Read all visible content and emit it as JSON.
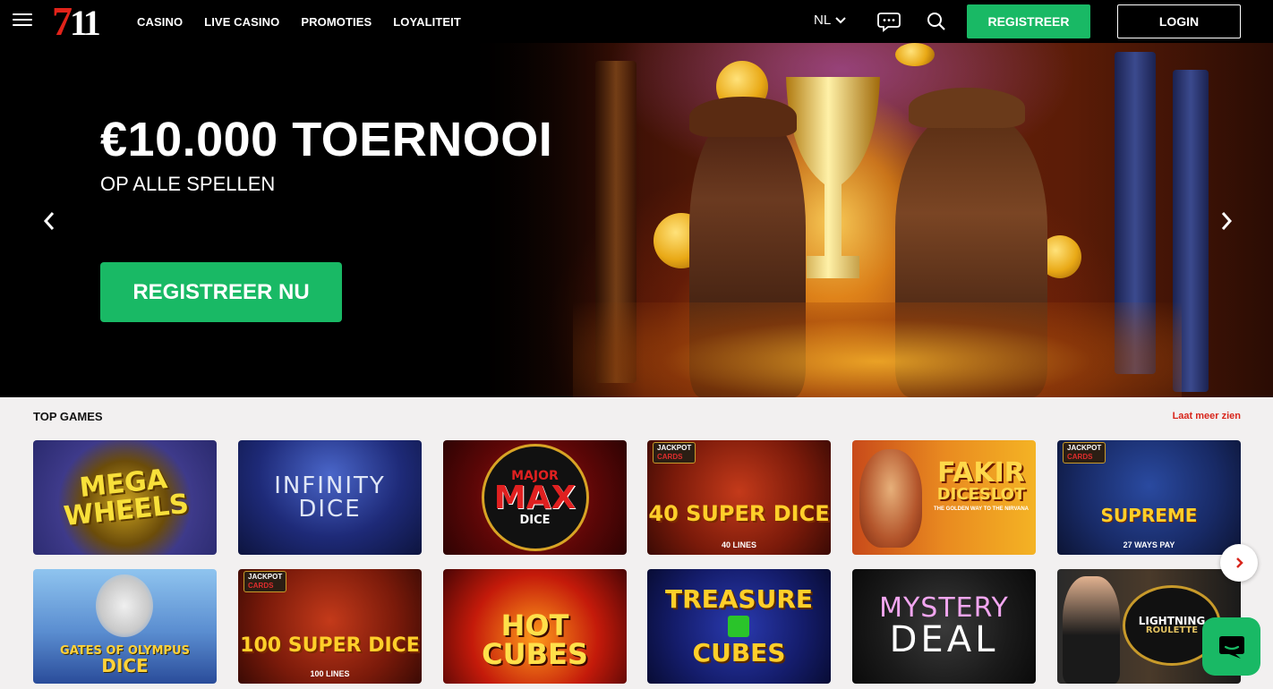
{
  "header": {
    "logo_seven": "7",
    "logo_eleven": "11",
    "nav": [
      "CASINO",
      "LIVE CASINO",
      "PROMOTIES",
      "LOYALITEIT"
    ],
    "language": "NL",
    "register_label": "REGISTREER",
    "login_label": "LOGIN"
  },
  "hero": {
    "title": "€10.000 TOERNOOI",
    "subtitle": "OP ALLE SPELLEN",
    "cta_label": "REGISTREER NU"
  },
  "top_games": {
    "title": "TOP GAMES",
    "see_more": "Laat meer zien",
    "games": [
      {
        "name": "MEGA WHEELS"
      },
      {
        "name": "INFINITY DICE"
      },
      {
        "name": "MAJOR MAX DICE",
        "line1": "MAJOR",
        "line2": "MAX",
        "line3": "DICE"
      },
      {
        "name": "40 SUPER DICE",
        "badge_top": "JACKPOT",
        "badge_bottom": "CARDS",
        "lines": "40 LINES"
      },
      {
        "name": "FAKIR DICESLOT",
        "line1": "FAKIR",
        "line2": "DICESLOT",
        "tagline": "THE GOLDEN WAY TO THE NIRVANA"
      },
      {
        "name": "SUPREME",
        "badge_top": "JACKPOT",
        "badge_bottom": "CARDS",
        "ways": "27 WAYS PAY"
      },
      {
        "name": "GATES OF OLYMPUS DICE",
        "line1": "GATES OF OLYMPUS",
        "line2": "DICE"
      },
      {
        "name": "100 SUPER DICE",
        "badge_top": "JACKPOT",
        "badge_bottom": "CARDS",
        "lines": "100 LINES"
      },
      {
        "name": "HOT CUBES",
        "line1": "HOT",
        "line2": "CUBES"
      },
      {
        "name": "TREASURE CUBES",
        "line1": "TREASURE",
        "line2": "CUBES"
      },
      {
        "name": "MYSTERY DEAL",
        "line1": "MYSTERY",
        "line2": "DEAL"
      },
      {
        "name": "LIGHTNING ROULETTE",
        "line1": "LIGHTNING",
        "line2": "ROULETTE"
      }
    ]
  },
  "colors": {
    "accent_green": "#19b965",
    "link_red": "#d8261c"
  }
}
